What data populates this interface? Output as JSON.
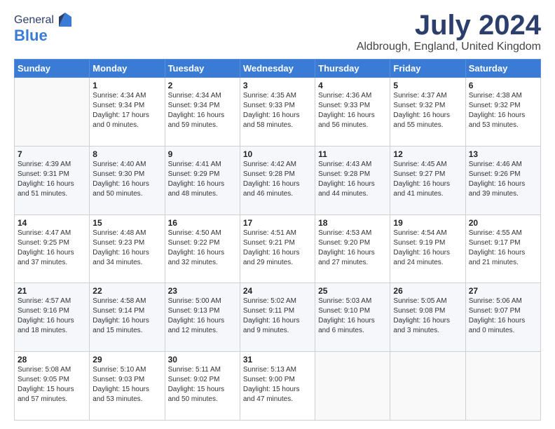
{
  "header": {
    "logo_line1": "General",
    "logo_line2": "Blue",
    "month_title": "July 2024",
    "location": "Aldbrough, England, United Kingdom"
  },
  "days_of_week": [
    "Sunday",
    "Monday",
    "Tuesday",
    "Wednesday",
    "Thursday",
    "Friday",
    "Saturday"
  ],
  "weeks": [
    [
      {
        "day": "",
        "sunrise": "",
        "sunset": "",
        "daylight": ""
      },
      {
        "day": "1",
        "sunrise": "Sunrise: 4:34 AM",
        "sunset": "Sunset: 9:34 PM",
        "daylight": "Daylight: 17 hours and 0 minutes."
      },
      {
        "day": "2",
        "sunrise": "Sunrise: 4:34 AM",
        "sunset": "Sunset: 9:34 PM",
        "daylight": "Daylight: 16 hours and 59 minutes."
      },
      {
        "day": "3",
        "sunrise": "Sunrise: 4:35 AM",
        "sunset": "Sunset: 9:33 PM",
        "daylight": "Daylight: 16 hours and 58 minutes."
      },
      {
        "day": "4",
        "sunrise": "Sunrise: 4:36 AM",
        "sunset": "Sunset: 9:33 PM",
        "daylight": "Daylight: 16 hours and 56 minutes."
      },
      {
        "day": "5",
        "sunrise": "Sunrise: 4:37 AM",
        "sunset": "Sunset: 9:32 PM",
        "daylight": "Daylight: 16 hours and 55 minutes."
      },
      {
        "day": "6",
        "sunrise": "Sunrise: 4:38 AM",
        "sunset": "Sunset: 9:32 PM",
        "daylight": "Daylight: 16 hours and 53 minutes."
      }
    ],
    [
      {
        "day": "7",
        "sunrise": "Sunrise: 4:39 AM",
        "sunset": "Sunset: 9:31 PM",
        "daylight": "Daylight: 16 hours and 51 minutes."
      },
      {
        "day": "8",
        "sunrise": "Sunrise: 4:40 AM",
        "sunset": "Sunset: 9:30 PM",
        "daylight": "Daylight: 16 hours and 50 minutes."
      },
      {
        "day": "9",
        "sunrise": "Sunrise: 4:41 AM",
        "sunset": "Sunset: 9:29 PM",
        "daylight": "Daylight: 16 hours and 48 minutes."
      },
      {
        "day": "10",
        "sunrise": "Sunrise: 4:42 AM",
        "sunset": "Sunset: 9:28 PM",
        "daylight": "Daylight: 16 hours and 46 minutes."
      },
      {
        "day": "11",
        "sunrise": "Sunrise: 4:43 AM",
        "sunset": "Sunset: 9:28 PM",
        "daylight": "Daylight: 16 hours and 44 minutes."
      },
      {
        "day": "12",
        "sunrise": "Sunrise: 4:45 AM",
        "sunset": "Sunset: 9:27 PM",
        "daylight": "Daylight: 16 hours and 41 minutes."
      },
      {
        "day": "13",
        "sunrise": "Sunrise: 4:46 AM",
        "sunset": "Sunset: 9:26 PM",
        "daylight": "Daylight: 16 hours and 39 minutes."
      }
    ],
    [
      {
        "day": "14",
        "sunrise": "Sunrise: 4:47 AM",
        "sunset": "Sunset: 9:25 PM",
        "daylight": "Daylight: 16 hours and 37 minutes."
      },
      {
        "day": "15",
        "sunrise": "Sunrise: 4:48 AM",
        "sunset": "Sunset: 9:23 PM",
        "daylight": "Daylight: 16 hours and 34 minutes."
      },
      {
        "day": "16",
        "sunrise": "Sunrise: 4:50 AM",
        "sunset": "Sunset: 9:22 PM",
        "daylight": "Daylight: 16 hours and 32 minutes."
      },
      {
        "day": "17",
        "sunrise": "Sunrise: 4:51 AM",
        "sunset": "Sunset: 9:21 PM",
        "daylight": "Daylight: 16 hours and 29 minutes."
      },
      {
        "day": "18",
        "sunrise": "Sunrise: 4:53 AM",
        "sunset": "Sunset: 9:20 PM",
        "daylight": "Daylight: 16 hours and 27 minutes."
      },
      {
        "day": "19",
        "sunrise": "Sunrise: 4:54 AM",
        "sunset": "Sunset: 9:19 PM",
        "daylight": "Daylight: 16 hours and 24 minutes."
      },
      {
        "day": "20",
        "sunrise": "Sunrise: 4:55 AM",
        "sunset": "Sunset: 9:17 PM",
        "daylight": "Daylight: 16 hours and 21 minutes."
      }
    ],
    [
      {
        "day": "21",
        "sunrise": "Sunrise: 4:57 AM",
        "sunset": "Sunset: 9:16 PM",
        "daylight": "Daylight: 16 hours and 18 minutes."
      },
      {
        "day": "22",
        "sunrise": "Sunrise: 4:58 AM",
        "sunset": "Sunset: 9:14 PM",
        "daylight": "Daylight: 16 hours and 15 minutes."
      },
      {
        "day": "23",
        "sunrise": "Sunrise: 5:00 AM",
        "sunset": "Sunset: 9:13 PM",
        "daylight": "Daylight: 16 hours and 12 minutes."
      },
      {
        "day": "24",
        "sunrise": "Sunrise: 5:02 AM",
        "sunset": "Sunset: 9:11 PM",
        "daylight": "Daylight: 16 hours and 9 minutes."
      },
      {
        "day": "25",
        "sunrise": "Sunrise: 5:03 AM",
        "sunset": "Sunset: 9:10 PM",
        "daylight": "Daylight: 16 hours and 6 minutes."
      },
      {
        "day": "26",
        "sunrise": "Sunrise: 5:05 AM",
        "sunset": "Sunset: 9:08 PM",
        "daylight": "Daylight: 16 hours and 3 minutes."
      },
      {
        "day": "27",
        "sunrise": "Sunrise: 5:06 AM",
        "sunset": "Sunset: 9:07 PM",
        "daylight": "Daylight: 16 hours and 0 minutes."
      }
    ],
    [
      {
        "day": "28",
        "sunrise": "Sunrise: 5:08 AM",
        "sunset": "Sunset: 9:05 PM",
        "daylight": "Daylight: 15 hours and 57 minutes."
      },
      {
        "day": "29",
        "sunrise": "Sunrise: 5:10 AM",
        "sunset": "Sunset: 9:03 PM",
        "daylight": "Daylight: 15 hours and 53 minutes."
      },
      {
        "day": "30",
        "sunrise": "Sunrise: 5:11 AM",
        "sunset": "Sunset: 9:02 PM",
        "daylight": "Daylight: 15 hours and 50 minutes."
      },
      {
        "day": "31",
        "sunrise": "Sunrise: 5:13 AM",
        "sunset": "Sunset: 9:00 PM",
        "daylight": "Daylight: 15 hours and 47 minutes."
      },
      {
        "day": "",
        "sunrise": "",
        "sunset": "",
        "daylight": ""
      },
      {
        "day": "",
        "sunrise": "",
        "sunset": "",
        "daylight": ""
      },
      {
        "day": "",
        "sunrise": "",
        "sunset": "",
        "daylight": ""
      }
    ]
  ]
}
